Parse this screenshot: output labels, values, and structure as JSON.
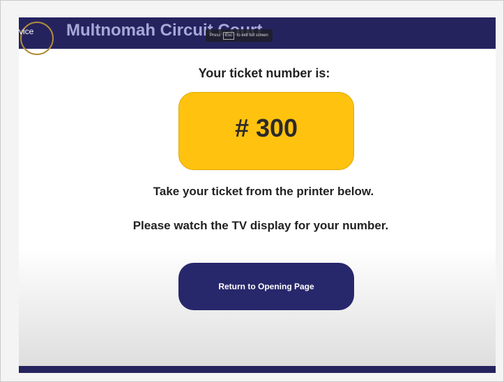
{
  "header": {
    "prefix": "vice",
    "title": "Multnomah Circuit Court"
  },
  "fullscreen_tip": {
    "before": "Press",
    "key": "Esc",
    "after": "to exit full screen"
  },
  "ticket": {
    "label": "Your ticket number is:",
    "number": "# 300",
    "color": "#ffc20e"
  },
  "instructions": {
    "line1": "Take your ticket from the printer below.",
    "line2": "Please watch the TV display for your number."
  },
  "actions": {
    "return_label": "Return to Opening Page"
  },
  "colors": {
    "brand_navy": "#25235e",
    "button_navy": "#27276b"
  }
}
